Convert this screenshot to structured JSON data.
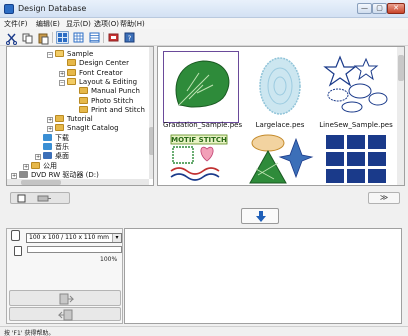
{
  "window": {
    "title": "Design Database",
    "min": "—",
    "max": "▢",
    "close": "✕"
  },
  "menu": [
    {
      "label": "文件(F)"
    },
    {
      "label": "编辑(E)"
    },
    {
      "label": "显示(D)"
    },
    {
      "label": "选项(O)"
    },
    {
      "label": "帮助(H)"
    }
  ],
  "toolbar": [
    "cut-icon",
    "copy-icon",
    "paste-icon",
    "large-thumbnail-icon",
    "medium-thumbnail-icon",
    "small-thumbnail-icon",
    "card-view-icon",
    "help-icon"
  ],
  "tree": [
    {
      "label": "Sample",
      "indent": 3,
      "expander": "⊟",
      "open": true
    },
    {
      "label": "Design Center",
      "indent": 4
    },
    {
      "label": "Font Creator",
      "indent": 4,
      "expander": "⊞"
    },
    {
      "label": "Layout & Editing",
      "indent": 4,
      "expander": "⊟",
      "open": true
    },
    {
      "label": "Manual Punch",
      "indent": 5
    },
    {
      "label": "Photo Stitch",
      "indent": 5
    },
    {
      "label": "Print and Stitch",
      "indent": 5
    },
    {
      "label": "Tutorial",
      "indent": 3,
      "expander": "⊞"
    },
    {
      "label": "SnagIt Catalog",
      "indent": 3,
      "expander": "⊞"
    },
    {
      "label": "下载",
      "indent": 2,
      "kind": "download"
    },
    {
      "label": "音乐",
      "indent": 2,
      "kind": "music"
    },
    {
      "label": "桌面",
      "indent": 2,
      "kind": "desktop",
      "expander": "⊞"
    },
    {
      "label": "公用",
      "indent": 1,
      "expander": "⊞"
    },
    {
      "label": "DVD RW 驱动器 (D:)",
      "indent": 0,
      "kind": "dvd",
      "expander": "⊞"
    }
  ],
  "thumbnails": [
    {
      "label": "Gradation_Sample.pes",
      "selected": true
    },
    {
      "label": "Largelace.pes",
      "selected": false
    },
    {
      "label": "LineSew_Sample.pes",
      "selected": false
    },
    {
      "label": "",
      "motif_text": "MOTIF STITCH"
    },
    {
      "label": ""
    },
    {
      "label": ""
    }
  ],
  "card": {
    "size_option": "100 x 100 / 110 x 110 mm",
    "progress_percent": 0,
    "progress_label": "100%"
  },
  "status": "按 'F1' 获得帮助。",
  "colors": {
    "accent": "#2b6cc4",
    "leaf": "#2e8b3a",
    "lace": "#a7d3e6",
    "navy": "#1a3a8a"
  }
}
